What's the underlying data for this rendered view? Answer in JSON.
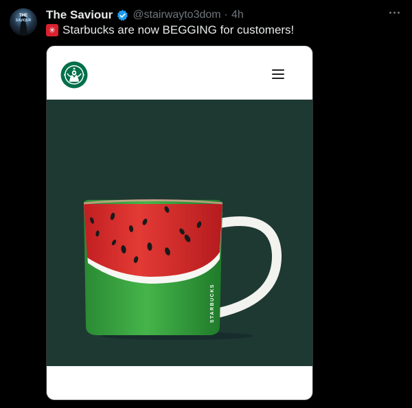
{
  "post": {
    "author_name": "The Saviour",
    "handle": "@stairwayto3dom",
    "separator": "·",
    "time": "4h",
    "text": "Starbucks are now BEGGING for customers!",
    "emoji": "siren-icon",
    "avatar_text": "THE SAVIOUR"
  },
  "card": {
    "brand": "Starbucks",
    "mug_wordmark": "STARBUCKS",
    "colors": {
      "hero_background": "#1e3932",
      "watermelon_red": "#d92b2b",
      "rind_green": "#2e9a3a"
    }
  },
  "colors": {
    "background": "#000000",
    "text_primary": "#e7e9ea",
    "text_secondary": "#71767b",
    "verified": "#1d9bf0"
  }
}
